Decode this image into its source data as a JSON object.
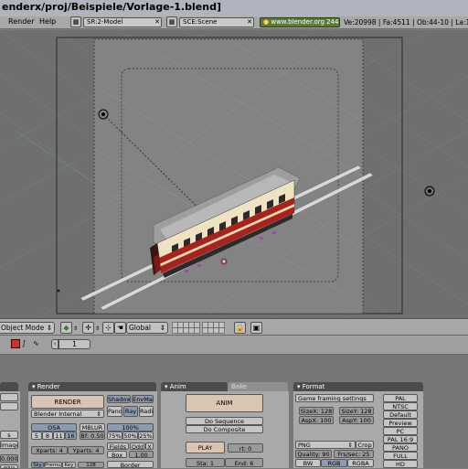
{
  "window": {
    "title": "enderx/proj/Beispiele/Vorlage-1.blend]"
  },
  "topbar": {
    "menus": [
      "Render",
      "Help"
    ],
    "screen_field": "SR:2-Model",
    "scene_field": "SCE:Scene",
    "url": "www.blender.org 244",
    "stats": "Ve:20998 | Fa:4511 | Ob:44-10 | La:1"
  },
  "view3d_header": {
    "mode": "Object Mode",
    "orientation": "Global"
  },
  "buttons_header": {
    "frame": "1"
  },
  "render_panel": {
    "tab": "Render",
    "render_button": "RENDER",
    "renderer": "Blender Internal",
    "shadow": "Shadow",
    "envmap": "EnvMa",
    "pano": "Pano",
    "ray": "Ray",
    "radio": "Radi",
    "osa": "OSA",
    "osa_values": [
      "5",
      "8",
      "11",
      "16"
    ],
    "mblur": "MBLUR",
    "bf": "Bf: 0.50",
    "percent_label": "100%",
    "percent_values": [
      "75%",
      "50%",
      "25%"
    ],
    "xparts": "Xparts: 4",
    "yparts": "Yparts: 4",
    "fields": "Fields",
    "odd": "Odd",
    "x": "X",
    "box": "Box",
    "filter": "1.00",
    "border": "Border",
    "bottom_row": [
      "Sky",
      "Premul",
      "Key",
      "128"
    ]
  },
  "left_panel": {
    "items": [
      "s",
      "Image",
      "0.000",
      "eous"
    ]
  },
  "anim_panel": {
    "tab_active": "Anim",
    "tab_inactive": "Bake",
    "anim_button": "ANIM",
    "do_sequence": "Do Sequence",
    "do_composite": "Do Composite",
    "play": "PLAY",
    "rt": "rt: 0",
    "sta": "Sta: 1",
    "end": "End: 6"
  },
  "format_panel": {
    "tab": "Format",
    "game_framing": "Game framing settings",
    "sizex": "SizeX: 128",
    "sizey": "SizeY: 128",
    "aspx": "AspX: 100",
    "aspy": "AspY: 100",
    "format": "PNG",
    "crop": "Crop",
    "quality": "Quality: 90",
    "frs_sec": "Frs/sec: 25",
    "bw": "BW",
    "rgb": "RGB",
    "rgba": "RGBA",
    "presets": [
      "PAL",
      "NTSC",
      "Default",
      "Preview",
      "PC",
      "PAL 16:9",
      "PANO",
      "FULL",
      "HD"
    ]
  },
  "colors": {
    "viewport_bg": "#6f6f6f",
    "camera_frame": "#8a8a8a",
    "train_cream": "#efe2c2",
    "train_red": "#a8231c",
    "train_roof": "#9e9e9e"
  }
}
